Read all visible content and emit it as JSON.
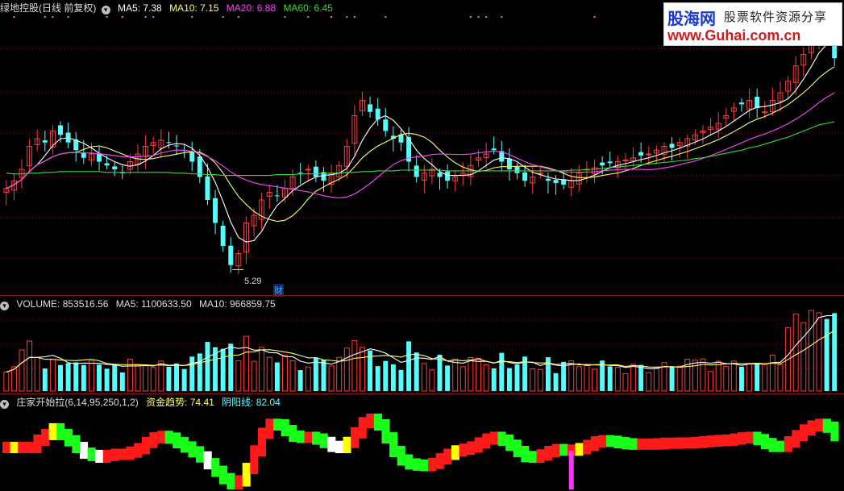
{
  "colors": {
    "up": "#ff3b3b",
    "down": "#54ffff",
    "ma5": "#ffffff",
    "ma10": "#ffff66",
    "ma20": "#ff44ff",
    "ma60": "#33dd33",
    "grid": "#8b1010",
    "ind_red": "#ff1a1a",
    "ind_green": "#1aff1a",
    "ind_yellow": "#ffff00",
    "ind_white": "#ffffff",
    "ind_magenta": "#ff33ff"
  },
  "price_header": {
    "title": "绿地控股(日线 前复权)",
    "ma5": "MA5: 7.38",
    "ma10": "MA10: 7.15",
    "ma20": "MA20: 6.88",
    "ma60": "MA60: 6.45"
  },
  "volume_header": {
    "volume": "VOLUME: 853516.56",
    "ma5": "MA5: 1100633.50",
    "ma10": "MA10: 966859.75"
  },
  "indicator_header": {
    "name": "庄家开始拉(6,14,95,250,1,2)",
    "trend": "资金趋势: 74.41",
    "yinyang": "阴阳线: 82.04"
  },
  "annotations": {
    "low_price": "5.29",
    "cai_marker": "财"
  },
  "logo": {
    "cn_name": "股海网",
    "tagline": "股票软件资源分享",
    "url": "www.Guhai.com.cn"
  },
  "chart_data": {
    "type": "candlestick",
    "x_count": 120,
    "price_ylim": [
      5.0,
      8.6
    ],
    "close": [
      6.35,
      6.45,
      6.6,
      6.9,
      7.0,
      6.95,
      7.1,
      7.05,
      6.95,
      6.85,
      6.75,
      6.8,
      6.7,
      6.65,
      6.6,
      6.55,
      6.7,
      6.8,
      6.9,
      6.95,
      6.98,
      6.95,
      6.9,
      6.85,
      6.7,
      6.5,
      6.2,
      5.9,
      5.6,
      5.35,
      5.5,
      5.9,
      6.0,
      6.2,
      6.3,
      6.25,
      6.35,
      6.5,
      6.55,
      6.6,
      6.5,
      6.45,
      6.55,
      6.65,
      6.9,
      7.3,
      7.5,
      7.35,
      7.25,
      7.1,
      7.0,
      6.95,
      6.7,
      6.5,
      6.55,
      6.6,
      6.5,
      6.45,
      6.5,
      6.55,
      6.65,
      6.75,
      6.8,
      6.85,
      6.7,
      6.6,
      6.55,
      6.45,
      6.5,
      6.55,
      6.45,
      6.42,
      6.4,
      6.45,
      6.55,
      6.6,
      6.62,
      6.65,
      6.68,
      6.7,
      6.72,
      6.75,
      6.78,
      6.8,
      6.85,
      6.9,
      6.88,
      6.95,
      7.0,
      7.05,
      7.1,
      7.15,
      7.2,
      7.3,
      7.4,
      7.45,
      7.5,
      7.4,
      7.35,
      7.5,
      7.6,
      7.75,
      7.95,
      8.1,
      8.3,
      8.5,
      8.3,
      8.05
    ],
    "ma60": [
      6.55,
      6.54,
      6.54,
      6.55,
      6.55,
      6.56,
      6.56,
      6.57,
      6.57,
      6.57,
      6.57,
      6.57,
      6.57,
      6.56,
      6.56,
      6.56,
      6.56,
      6.56,
      6.56,
      6.56,
      6.56,
      6.56,
      6.55,
      6.55,
      6.54,
      6.54,
      6.53,
      6.53,
      6.52,
      6.52,
      6.52,
      6.52,
      6.52,
      6.52,
      6.52,
      6.53,
      6.53,
      6.53,
      6.54,
      6.54,
      6.54,
      6.55,
      6.55,
      6.55,
      6.56,
      6.56,
      6.57,
      6.57,
      6.58,
      6.58,
      6.58,
      6.59,
      6.59,
      6.59,
      6.59,
      6.59,
      6.59,
      6.58,
      6.58,
      6.58,
      6.58,
      6.58,
      6.58,
      6.58,
      6.58,
      6.58,
      6.58,
      6.58,
      6.58,
      6.58,
      6.58,
      6.58,
      6.58,
      6.59,
      6.59,
      6.6,
      6.6,
      6.61,
      6.62,
      6.63,
      6.64,
      6.65,
      6.66,
      6.67,
      6.68,
      6.69,
      6.7,
      6.71,
      6.72,
      6.74,
      6.75,
      6.77,
      6.79,
      6.81,
      6.83,
      6.85,
      6.88,
      6.9,
      6.93,
      6.96,
      6.99,
      7.02,
      7.06,
      7.1,
      7.14,
      7.18,
      7.2,
      7.22
    ],
    "low_marker_value": 5.29,
    "indicator_ylim": [
      0,
      100
    ]
  }
}
